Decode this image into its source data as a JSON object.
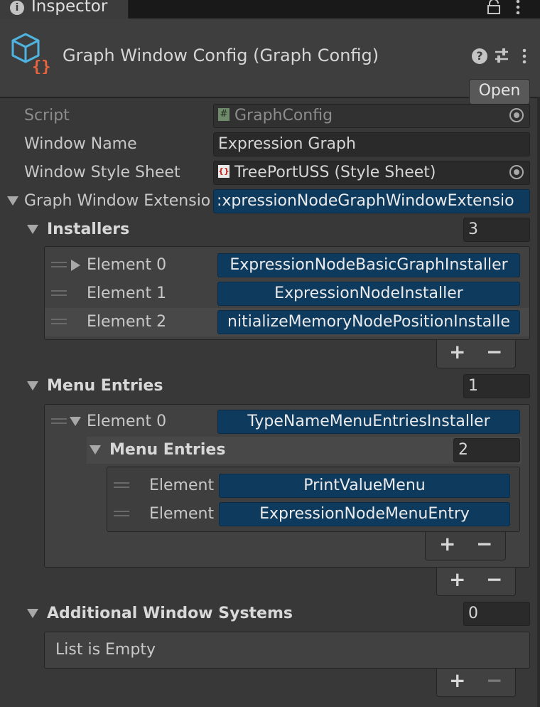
{
  "tab": {
    "label": "Inspector"
  },
  "header": {
    "title": "Graph Window Config (Graph Config)",
    "open_label": "Open",
    "asset_icon": "scriptable-object-icon"
  },
  "fields": {
    "script_label": "Script",
    "script_value": "GraphConfig",
    "window_name_label": "Window Name",
    "window_name_value": "Expression Graph",
    "style_sheet_label": "Window Style Sheet",
    "style_sheet_value": "TreePortUSS (Style Sheet)",
    "extension_label": "Graph Window Extensio",
    "extension_value": ":xpressionNodeGraphWindowExtensio"
  },
  "installers": {
    "label": "Installers",
    "size": "3",
    "items": [
      {
        "label": "Element 0",
        "value": "ExpressionNodeBasicGraphInstaller"
      },
      {
        "label": "Element 1",
        "value": "ExpressionNodeInstaller"
      },
      {
        "label": "Element 2",
        "value": "nitializeMemoryNodePositionInstalle"
      }
    ]
  },
  "menu_entries": {
    "label": "Menu Entries",
    "size": "1",
    "element0": {
      "label": "Element 0",
      "value": "TypeNameMenuEntriesInstaller"
    },
    "inner": {
      "label": "Menu Entries",
      "size": "2",
      "items": [
        {
          "label": "Element",
          "value": "PrintValueMenu"
        },
        {
          "label": "Element",
          "value": "ExpressionNodeMenuEntry"
        }
      ]
    }
  },
  "additional": {
    "label": "Additional Window Systems",
    "size": "0",
    "empty_text": "List is Empty"
  },
  "controls": {
    "plus": "+",
    "minus": "−"
  }
}
